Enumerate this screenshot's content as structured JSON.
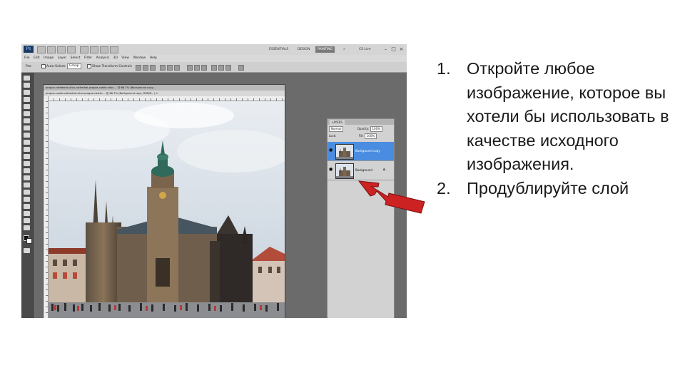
{
  "slide": {
    "steps": [
      {
        "number": "1.",
        "text": "Откройте любое изображение, которое вы хотели бы использовать в качестве исходного изображения."
      },
      {
        "number": "2.",
        "text": "Продублируйте слой"
      }
    ]
  },
  "photoshop": {
    "logo_text": "Ps",
    "workspace_buttons": [
      "ESSENTIALS",
      "DESIGN",
      "PAINTING"
    ],
    "active_workspace": "PAINTING",
    "cs_live": "CS Live",
    "menu": [
      "File",
      "Edit",
      "Image",
      "Layer",
      "Select",
      "Filter",
      "Analysis",
      "3D",
      "View",
      "Window",
      "Help"
    ],
    "options_bar": {
      "tool": "Pse",
      "auto_select_label": "Auto-Select:",
      "auto_select_value": "Group",
      "show_transform_label": "Show Transform Controls"
    },
    "document_tabs": [
      "prague-cathedral-vitus-cathedral-prague-castle-vitus-... @ 66.7% (Background copy...",
      "prague-castle-cathedral-vitus-prague-castle-... @ 66.7% (Background copy, RGB/8...) ×"
    ],
    "layers_panel": {
      "tab": "LAYERS",
      "blend_mode": "Normal",
      "opacity_label": "Opacity:",
      "opacity": "100%",
      "lock_label": "Lock:",
      "fill_label": "Fill:",
      "fill": "100%",
      "layers": [
        {
          "name": "Background copy",
          "selected": true
        },
        {
          "name": "Background",
          "selected": false
        }
      ]
    }
  },
  "colors": {
    "arrow": "#cc2222",
    "selected_layer": "#4a8de0",
    "app_bg": "#6b6b6b"
  }
}
